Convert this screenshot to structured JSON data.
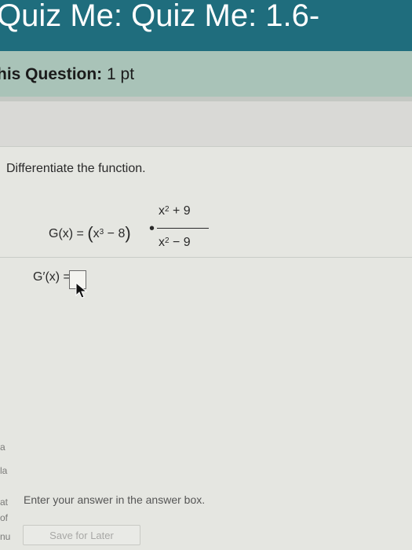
{
  "header": {
    "title": "Quiz Me: Quiz Me: 1.6-"
  },
  "question_bar": {
    "label": "his Question:",
    "points": "1 pt"
  },
  "question": {
    "instruction": "Differentiate the function.",
    "function": {
      "lhs": "G(x) =",
      "factor1_open": "(",
      "factor1_base1": "x",
      "factor1_exp": "3",
      "factor1_rest": " − 8",
      "factor1_close": ")",
      "operator": "•",
      "numerator_base": "x",
      "numerator_exp": "2",
      "numerator_rest": " + 9",
      "denominator_base": "x",
      "denominator_exp": "2",
      "denominator_rest": " − 9"
    },
    "answer_label": "G′(x) ="
  },
  "sidebar_fragments": [
    "a",
    "la",
    "at",
    "of",
    "nu"
  ],
  "footer": {
    "hint": "Enter your answer in the answer box.",
    "save_label": "Save for Later"
  },
  "colors": {
    "header_bg": "#1f6d7d",
    "question_bar_bg": "#a9c3b8",
    "panel_bg": "#e5e6e1"
  }
}
